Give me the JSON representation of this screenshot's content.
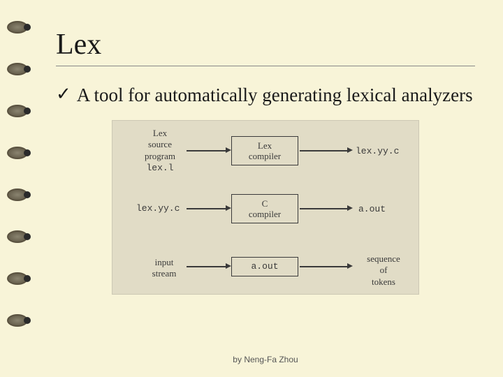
{
  "title": "Lex",
  "bullet": "A tool for automatically generating  lexical analyzers",
  "footer": "by Neng-Fa Zhou",
  "diagram": {
    "rows": [
      {
        "input_line1": "Lex",
        "input_line2": "source",
        "input_line3": "program",
        "input_code": "lex.l",
        "box_line1": "Lex",
        "box_line2": "compiler",
        "output": "lex.yy.c"
      },
      {
        "input_code": "lex.yy.c",
        "box_line1": "C",
        "box_line2": "compiler",
        "output": "a.out"
      },
      {
        "input_line1": "input",
        "input_line2": "stream",
        "box_line1": "a.out",
        "output_line1": "sequence",
        "output_line2": "of",
        "output_line3": "tokens"
      }
    ]
  }
}
